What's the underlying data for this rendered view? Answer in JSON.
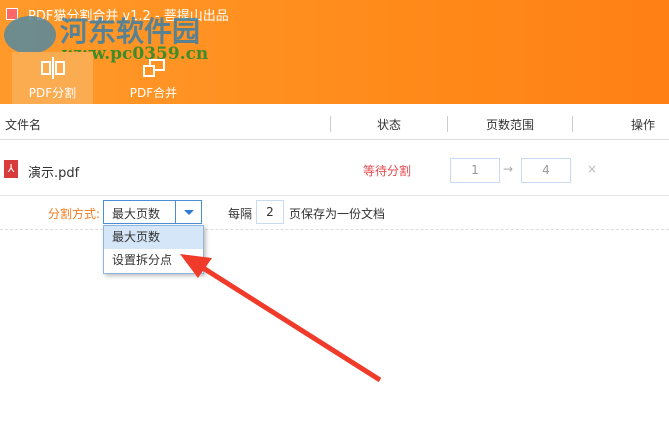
{
  "window": {
    "title": "PDF猫分割合并 v1.2 - 菩提山出品"
  },
  "watermark": {
    "name": "河东软件园",
    "url": "www.pc0359.cn"
  },
  "tabs": [
    {
      "label": "PDF分割",
      "icon": "split-icon",
      "active": true
    },
    {
      "label": "PDF合并",
      "icon": "merge-icon",
      "active": false
    }
  ],
  "columns": {
    "file": "文件名",
    "status": "状态",
    "range": "页数范围",
    "action": "操作"
  },
  "files": [
    {
      "name": "演示.pdf",
      "status": "等待分割",
      "start": "1",
      "end": "4",
      "arrow": "→",
      "delete": "×"
    }
  ],
  "split": {
    "label": "分割方式:",
    "selected": "最大页数",
    "every": "每隔",
    "pages": "2",
    "suffix": "页保存为一份文档",
    "options": [
      "最大页数",
      "设置拆分点"
    ]
  },
  "colors": {
    "accent": "#ff8a1a",
    "status": "#e5484d",
    "annotation": "#f03a2a"
  }
}
